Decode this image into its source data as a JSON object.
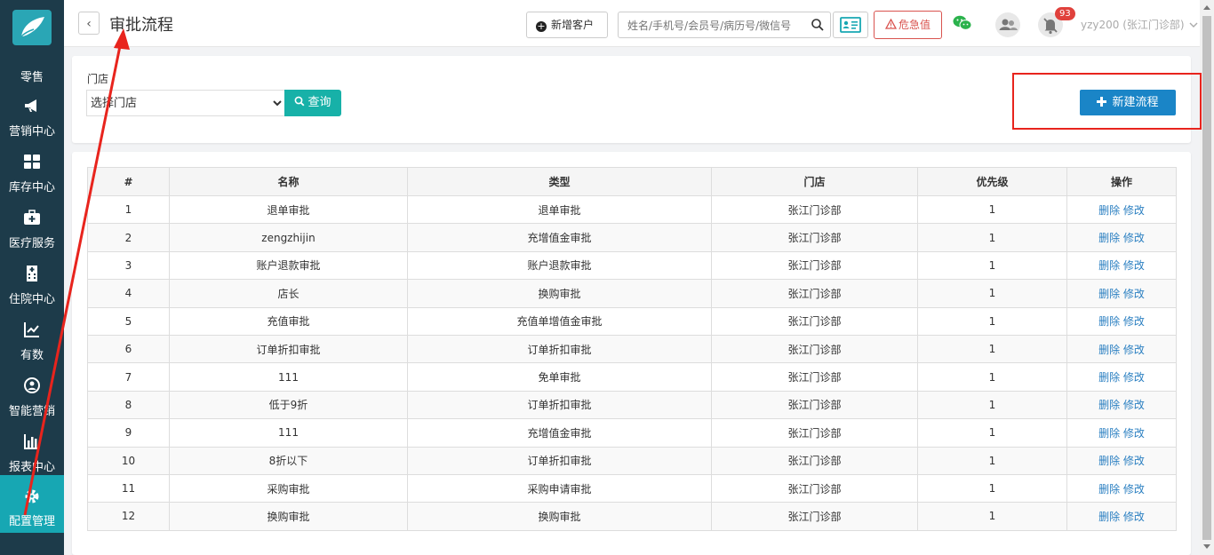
{
  "sidebar": {
    "items": [
      {
        "label": "零售",
        "icon": "retail-icon"
      },
      {
        "label": "营销中心",
        "icon": "megaphone-icon"
      },
      {
        "label": "库存中心",
        "icon": "grid-icon"
      },
      {
        "label": "医疗服务",
        "icon": "medical-kit-icon"
      },
      {
        "label": "住院中心",
        "icon": "hospital-icon"
      },
      {
        "label": "有数",
        "icon": "trend-chart-icon"
      },
      {
        "label": "智能营销",
        "icon": "smart-marketing-icon"
      },
      {
        "label": "报表中心",
        "icon": "bar-chart-icon"
      },
      {
        "label": "配置管理",
        "icon": "gear-icon"
      }
    ]
  },
  "header": {
    "back_label": "‹",
    "title": "审批流程",
    "new_customer_label": "新增客户",
    "search_placeholder": "姓名/手机号/会员号/病历号/微信号",
    "danger_label": "危急值",
    "notification_count": "93",
    "user_label": "yzy200 (张江门诊部)"
  },
  "filter": {
    "store_label": "门店",
    "store_select_value": "选择门店",
    "query_label": "查询",
    "new_flow_label": "新建流程"
  },
  "table": {
    "headers": [
      "#",
      "名称",
      "类型",
      "门店",
      "优先级",
      "操作"
    ],
    "delete_label": "删除",
    "edit_label": "修改",
    "rows": [
      {
        "no": "1",
        "name": "退单审批",
        "type": "退单审批",
        "store": "张江门诊部",
        "priority": "1"
      },
      {
        "no": "2",
        "name": "zengzhijin",
        "type": "充增值金审批",
        "store": "张江门诊部",
        "priority": "1"
      },
      {
        "no": "3",
        "name": "账户退款审批",
        "type": "账户退款审批",
        "store": "张江门诊部",
        "priority": "1"
      },
      {
        "no": "4",
        "name": "店长",
        "type": "换购审批",
        "store": "张江门诊部",
        "priority": "1"
      },
      {
        "no": "5",
        "name": "充值审批",
        "type": "充值单增值金审批",
        "store": "张江门诊部",
        "priority": "1"
      },
      {
        "no": "6",
        "name": "订单折扣审批",
        "type": "订单折扣审批",
        "store": "张江门诊部",
        "priority": "1"
      },
      {
        "no": "7",
        "name": "111",
        "type": "免单审批",
        "store": "张江门诊部",
        "priority": "1"
      },
      {
        "no": "8",
        "name": "低于9折",
        "type": "订单折扣审批",
        "store": "张江门诊部",
        "priority": "1"
      },
      {
        "no": "9",
        "name": "111",
        "type": "充增值金审批",
        "store": "张江门诊部",
        "priority": "1"
      },
      {
        "no": "10",
        "name": "8折以下",
        "type": "订单折扣审批",
        "store": "张江门诊部",
        "priority": "1"
      },
      {
        "no": "11",
        "name": "采购审批",
        "type": "采购申请审批",
        "store": "张江门诊部",
        "priority": "1"
      },
      {
        "no": "12",
        "name": "换购审批",
        "type": "换购审批",
        "store": "张江门诊部",
        "priority": "1"
      }
    ]
  },
  "colors": {
    "sidebar_bg": "#1d3b4a",
    "active_nav": "#17a7b3",
    "query_btn": "#17b1a8",
    "new_flow_btn": "#1a85c7",
    "annotation_red": "#e8241d",
    "link": "#2a7fc1"
  }
}
